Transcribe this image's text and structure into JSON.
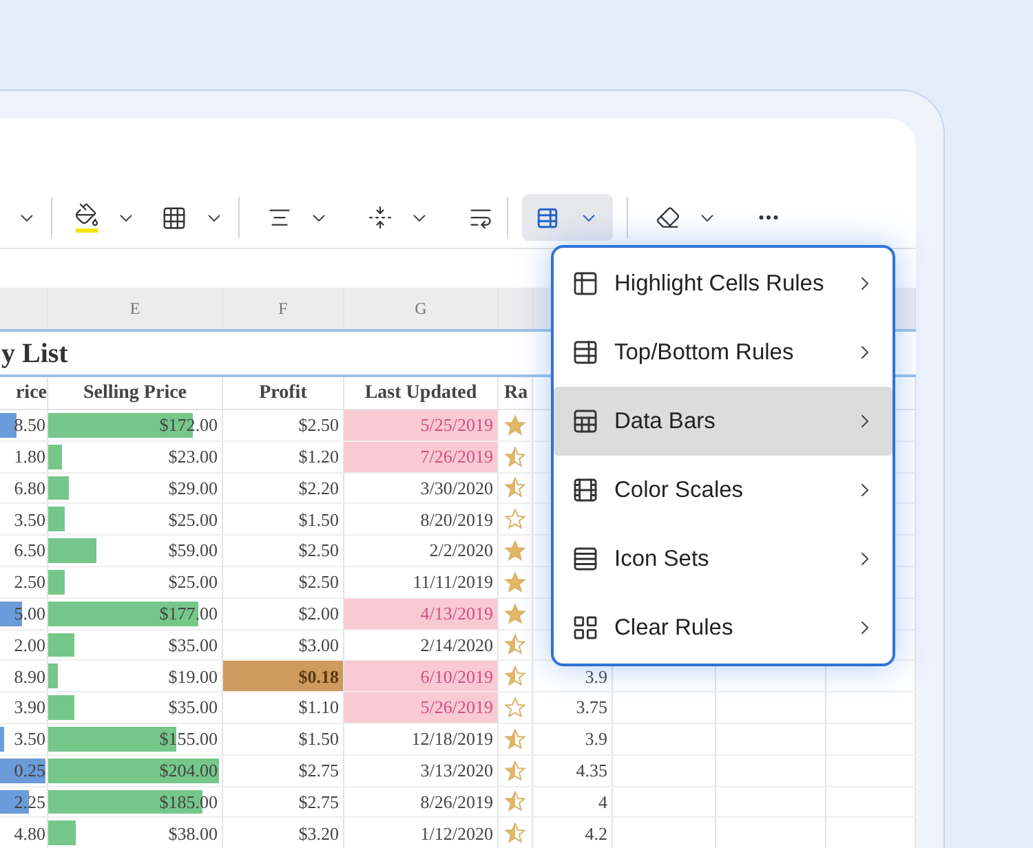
{
  "toolbar": {
    "format_button": {
      "selected": true
    }
  },
  "sheet": {
    "column_letters": [
      "E",
      "F",
      "G"
    ],
    "title": "y List",
    "headers": [
      "rice",
      "Selling Price",
      "Profit",
      "Last Updated",
      "Ra"
    ],
    "rows": [
      {
        "price": {
          "value": "8.50",
          "level": 0.35
        },
        "selling_price": {
          "value": "$172.00",
          "level": 0.85
        },
        "profit": "$2.50",
        "profit_highlighted": false,
        "updated": "5/25/2019",
        "updated_highlighted": true,
        "kind": "full"
      },
      {
        "price": {
          "value": "1.80"
        },
        "selling_price": {
          "value": "$23.00",
          "level": 0.08
        },
        "profit": "$1.20",
        "profit_highlighted": false,
        "updated": "7/26/2019",
        "updated_highlighted": true,
        "kind": "half"
      },
      {
        "price": {
          "value": "6.80"
        },
        "selling_price": {
          "value": "$29.00",
          "level": 0.12
        },
        "profit": "$2.20",
        "profit_highlighted": false,
        "updated": "3/30/2020",
        "updated_highlighted": false,
        "kind": "half"
      },
      {
        "price": {
          "value": "3.50"
        },
        "selling_price": {
          "value": "$25.00",
          "level": 0.1
        },
        "profit": "$1.50",
        "profit_highlighted": false,
        "updated": "8/20/2019",
        "updated_highlighted": false,
        "kind": "empty"
      },
      {
        "price": {
          "value": "6.50"
        },
        "selling_price": {
          "value": "$59.00",
          "level": 0.28
        },
        "profit": "$2.50",
        "profit_highlighted": false,
        "updated": "2/2/2020",
        "updated_highlighted": false,
        "kind": "full"
      },
      {
        "price": {
          "value": "2.50"
        },
        "selling_price": {
          "value": "$25.00",
          "level": 0.1
        },
        "profit": "$2.50",
        "profit_highlighted": false,
        "updated": "11/11/2019",
        "updated_highlighted": false,
        "kind": "full"
      },
      {
        "price": {
          "value": "5.00",
          "level": 0.45
        },
        "selling_price": {
          "value": "$177.00",
          "level": 0.88
        },
        "profit": "$2.00",
        "profit_highlighted": false,
        "updated": "4/13/2019",
        "updated_highlighted": true,
        "kind": "full"
      },
      {
        "price": {
          "value": "2.00"
        },
        "selling_price": {
          "value": "$35.00",
          "level": 0.15
        },
        "profit": "$3.00",
        "profit_highlighted": false,
        "updated": "2/14/2020",
        "updated_highlighted": false,
        "kind": "half"
      },
      {
        "price": {
          "value": "8.90"
        },
        "selling_price": {
          "value": "$19.00",
          "level": 0.06
        },
        "profit": "$0.18",
        "profit_highlighted": true,
        "updated": "6/10/2019",
        "updated_highlighted": true,
        "kind": "half",
        "rating": "3.9"
      },
      {
        "price": {
          "value": "3.90"
        },
        "selling_price": {
          "value": "$35.00",
          "level": 0.15
        },
        "profit": "$1.10",
        "profit_highlighted": false,
        "updated": "5/26/2019",
        "updated_highlighted": true,
        "kind": "empty",
        "rating": "3.75"
      },
      {
        "price": {
          "value": "3.50",
          "level": 0.08
        },
        "selling_price": {
          "value": "$155.00",
          "level": 0.75
        },
        "profit": "$1.50",
        "profit_highlighted": false,
        "updated": "12/18/2019",
        "updated_highlighted": false,
        "kind": "half",
        "rating": "3.9"
      },
      {
        "price": {
          "value": "0.25",
          "level": 0.95
        },
        "selling_price": {
          "value": "$204.00",
          "level": 1
        },
        "profit": "$2.75",
        "profit_highlighted": false,
        "updated": "3/13/2020",
        "updated_highlighted": false,
        "kind": "half",
        "rating": "4.35"
      },
      {
        "price": {
          "value": "2.25",
          "level": 0.6
        },
        "selling_price": {
          "value": "$185.00",
          "level": 0.9
        },
        "profit": "$2.75",
        "profit_highlighted": false,
        "updated": "8/26/2019",
        "updated_highlighted": false,
        "kind": "half",
        "rating": "4"
      },
      {
        "price": {
          "value": "4.80"
        },
        "selling_price": {
          "value": "$38.00",
          "level": 0.16
        },
        "profit": "$3.20",
        "profit_highlighted": false,
        "updated": "1/12/2020",
        "updated_highlighted": false,
        "kind": "half",
        "rating": "4.2"
      }
    ]
  },
  "menu": {
    "items": [
      {
        "label": "Highlight Cells Rules",
        "selected": false
      },
      {
        "label": "Top/Bottom Rules",
        "selected": false
      },
      {
        "label": "Data Bars",
        "selected": true
      },
      {
        "label": "Color Scales",
        "selected": false
      },
      {
        "label": "Icon Sets",
        "selected": false
      },
      {
        "label": "Clear Rules",
        "selected": false
      }
    ]
  }
}
